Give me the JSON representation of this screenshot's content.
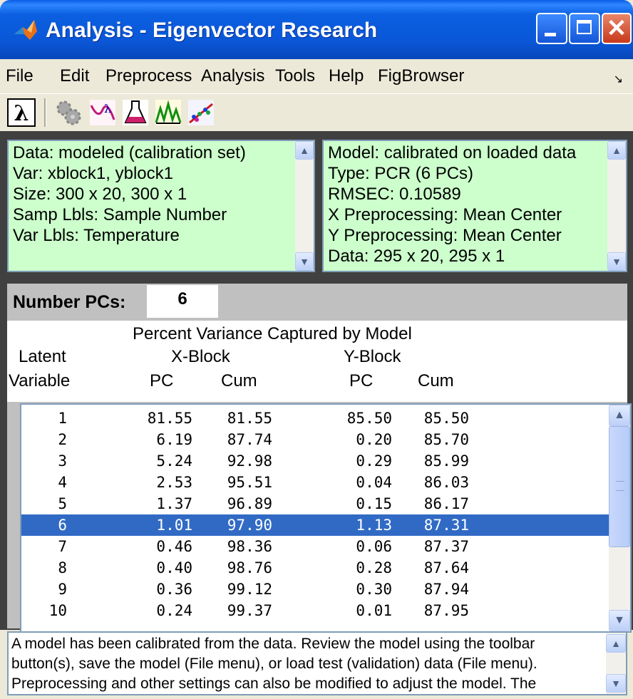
{
  "window": {
    "title": "Analysis - Eigenvector Research"
  },
  "menu": [
    "File",
    "Edit",
    "Preprocess",
    "Analysis",
    "Tools",
    "Help",
    "FigBrowser"
  ],
  "toolbar": {
    "icons": [
      "lambda-icon",
      "gear-icon",
      "scores-icon",
      "flask-icon",
      "spectra-icon",
      "prediction-icon"
    ]
  },
  "data_info": {
    "lines": [
      "Data: modeled (calibration set)",
      "Var: xblock1, yblock1",
      "Size: 300 x 20, 300 x 1",
      "Samp Lbls: Sample Number",
      "Var Lbls: Temperature"
    ]
  },
  "model_info": {
    "lines": [
      "Model: calibrated on loaded data",
      "Type: PCR (6 PCs)",
      "RMSEC: 0.10589",
      "X Preprocessing: Mean Center",
      "Y Preprocessing: Mean Center",
      "Data: 295 x 20, 295 x 1"
    ]
  },
  "pcs": {
    "label": "Number PCs:",
    "value": "6",
    "table_title": "Percent Variance Captured by Model",
    "headers": {
      "latent": "Latent",
      "variable": "Variable",
      "xblock": "X-Block",
      "yblock": "Y-Block",
      "x_pc": "PC",
      "x_cum": "Cum",
      "y_pc": "PC",
      "y_cum": "Cum"
    },
    "rows": [
      [
        "1",
        "81.55",
        "81.55",
        "85.50",
        "85.50"
      ],
      [
        "2",
        "6.19",
        "87.74",
        "0.20",
        "85.70"
      ],
      [
        "3",
        "5.24",
        "92.98",
        "0.29",
        "85.99"
      ],
      [
        "4",
        "2.53",
        "95.51",
        "0.04",
        "86.03"
      ],
      [
        "5",
        "1.37",
        "96.89",
        "0.15",
        "86.17"
      ],
      [
        "6",
        "1.01",
        "97.90",
        "1.13",
        "87.31"
      ],
      [
        "7",
        "0.46",
        "98.36",
        "0.06",
        "87.37"
      ],
      [
        "8",
        "0.40",
        "98.76",
        "0.28",
        "87.64"
      ],
      [
        "9",
        "0.36",
        "99.12",
        "0.30",
        "87.94"
      ],
      [
        "10",
        "0.24",
        "99.37",
        "0.01",
        "87.95"
      ]
    ],
    "selected_row": "6"
  },
  "status": {
    "lines": [
      "A model has been calibrated from the data. Review the model using the toolbar",
      "button(s), save the model (File menu), or load test (validation) data (File menu).",
      "Preprocessing and other settings can also be modified to adjust the model. The"
    ]
  },
  "colors": {
    "info_background": "#ccffcc",
    "selection": "#316ac5",
    "titlebar": "#0a57d8"
  }
}
